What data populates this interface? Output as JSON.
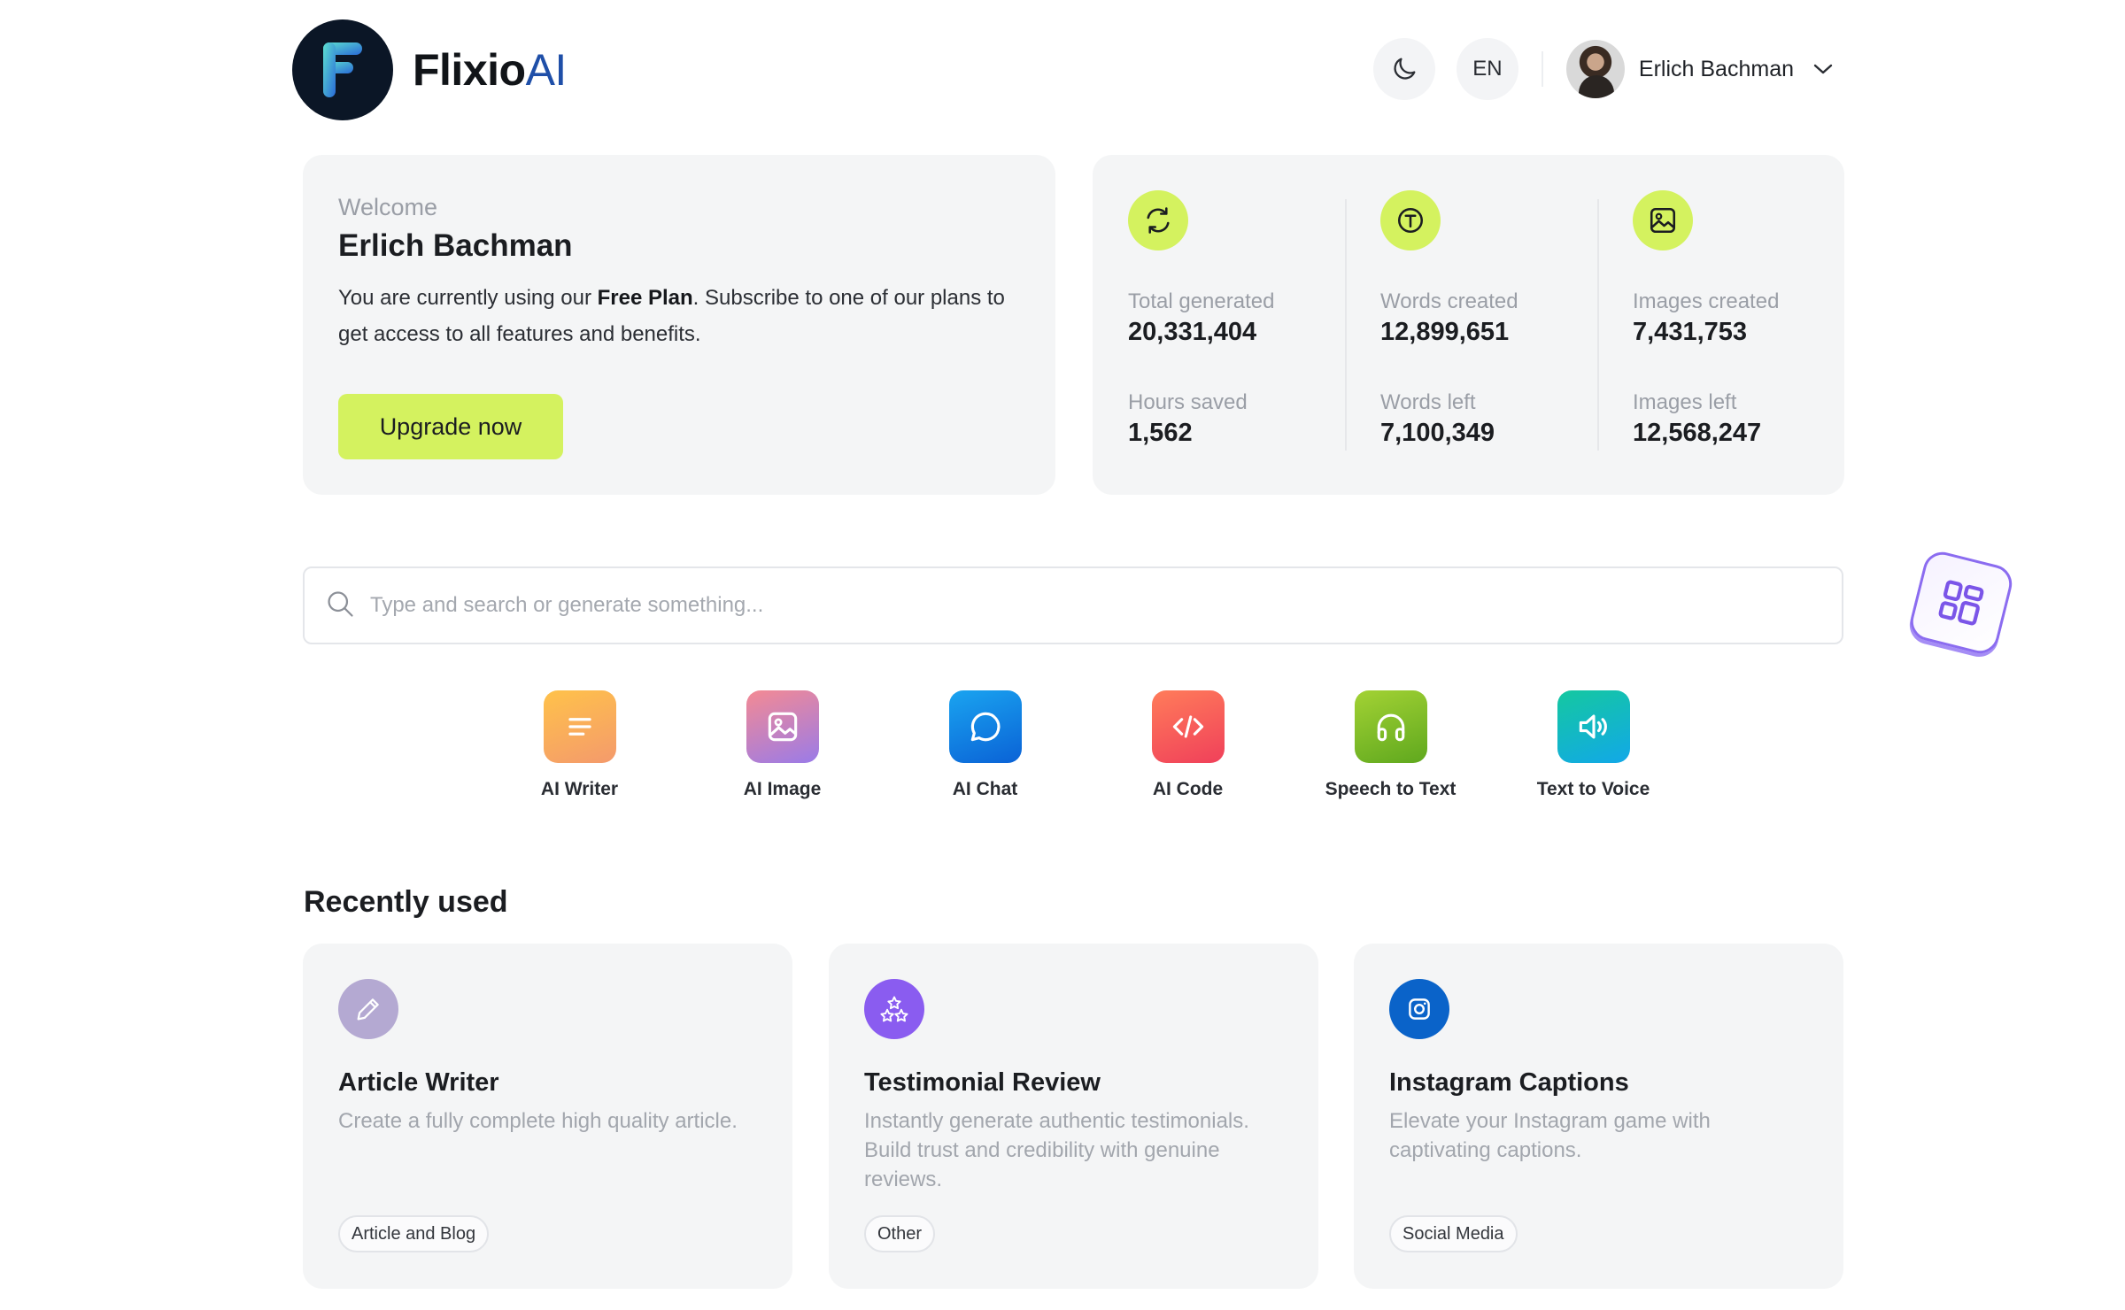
{
  "header": {
    "logo_text": "Flixio",
    "logo_accent": "AI",
    "language": "EN",
    "user_name": "Erlich Bachman",
    "icons": [
      "logo-mark",
      "moon-icon",
      "chevron-down-icon"
    ]
  },
  "welcome": {
    "greeting": "Welcome",
    "name": "Erlich Bachman",
    "desc_before": "You are currently using our ",
    "plan": "Free Plan",
    "desc_after": ". Subscribe to one of our plans to get access to all features and benefits.",
    "upgrade_label": "Upgrade now"
  },
  "stats": {
    "columns": [
      {
        "icon": "refresh-icon",
        "label1": "Total generated",
        "value1": "20,331,404",
        "label2": "Hours saved",
        "value2": "1,562"
      },
      {
        "icon": "text-icon",
        "label1": "Words created",
        "value1": "12,899,651",
        "label2": "Words left",
        "value2": "7,100,349"
      },
      {
        "icon": "image-icon",
        "label1": "Images created",
        "value1": "7,431,753",
        "label2": "Images left",
        "value2": "12,568,247"
      }
    ],
    "accent_color": "#d4f25f"
  },
  "search": {
    "placeholder": "Type and search or generate something..."
  },
  "tools": [
    {
      "label": "AI Writer",
      "icon": "lines-icon",
      "gradient": [
        "#ffc24a",
        "#f49a6c"
      ]
    },
    {
      "label": "AI Image",
      "icon": "image-icon",
      "gradient": [
        "#f48a93",
        "#9a7be8"
      ]
    },
    {
      "label": "AI Chat",
      "icon": "chat-bubble-icon",
      "gradient": [
        "#1aa4f0",
        "#0a62d6"
      ]
    },
    {
      "label": "AI Code",
      "icon": "code-icon",
      "gradient": [
        "#ff7c5a",
        "#f0405a"
      ]
    },
    {
      "label": "Speech to Text",
      "icon": "headphones-icon",
      "gradient": [
        "#a3d234",
        "#5fa81e"
      ]
    },
    {
      "label": "Text to Voice",
      "icon": "speaker-icon",
      "gradient": [
        "#14c8a0",
        "#12a8e8"
      ]
    }
  ],
  "recent": {
    "title": "Recently used",
    "items": [
      {
        "title": "Article Writer",
        "desc": "Create a fully complete high quality article.",
        "tag": "Article and Blog",
        "icon": "pencil-icon",
        "color": "#b4a9d2"
      },
      {
        "title": "Testimonial Review",
        "desc": "Instantly generate authentic testimonials. Build trust and credibility with genuine reviews.",
        "tag": "Other",
        "icon": "stars-icon",
        "color": "#8a5cf0"
      },
      {
        "title": "Instagram Captions",
        "desc": "Elevate your Instagram game with captivating captions.",
        "tag": "Social Media",
        "icon": "instagram-icon",
        "color": "#0a63c9"
      }
    ]
  }
}
